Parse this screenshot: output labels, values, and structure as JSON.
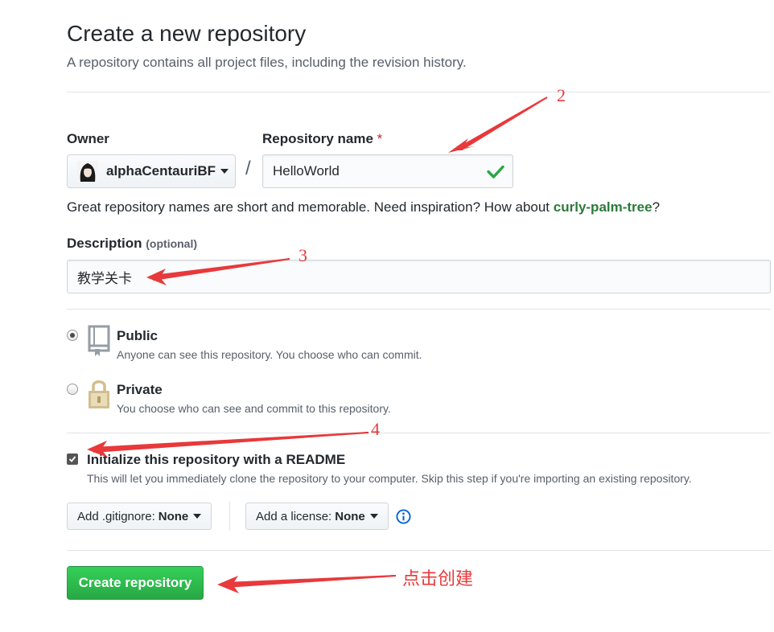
{
  "header": {
    "title": "Create a new repository",
    "subtitle": "A repository contains all project files, including the revision history."
  },
  "owner": {
    "label": "Owner",
    "value": "alphaCentauriBF"
  },
  "repo_name": {
    "label": "Repository name",
    "required_mark": "*",
    "value": "HelloWorld"
  },
  "hint": {
    "text": "Great repository names are short and memorable. Need inspiration? How about ",
    "suggestion": "curly-palm-tree",
    "suffix": "?"
  },
  "description": {
    "label": "Description",
    "optional": "(optional)",
    "value": "教学关卡"
  },
  "visibility": {
    "selected": "public",
    "public": {
      "title": "Public",
      "note": "Anyone can see this repository. You choose who can commit."
    },
    "private": {
      "title": "Private",
      "note": "You choose who can see and commit to this repository."
    }
  },
  "readme": {
    "checked": true,
    "label": "Initialize this repository with a README",
    "note": "This will let you immediately clone the repository to your computer. Skip this step if you're importing an existing repository."
  },
  "gitignore": {
    "prefix": "Add .gitignore:",
    "value": "None"
  },
  "license": {
    "prefix": "Add a license:",
    "value": "None"
  },
  "create_button": "Create repository",
  "annotations": {
    "step2": "2",
    "step3": "3",
    "step4": "4",
    "click_create": "点击创建",
    "color": "#e8393b"
  },
  "colors": {
    "primary_button": "#2ea44f",
    "suggestion": "#2c7a3a",
    "required": "#cb2431",
    "valid_check": "#28a745"
  },
  "icons": {
    "valid": "check-icon",
    "public": "repo-book-icon",
    "private": "lock-icon",
    "info": "info-icon"
  }
}
